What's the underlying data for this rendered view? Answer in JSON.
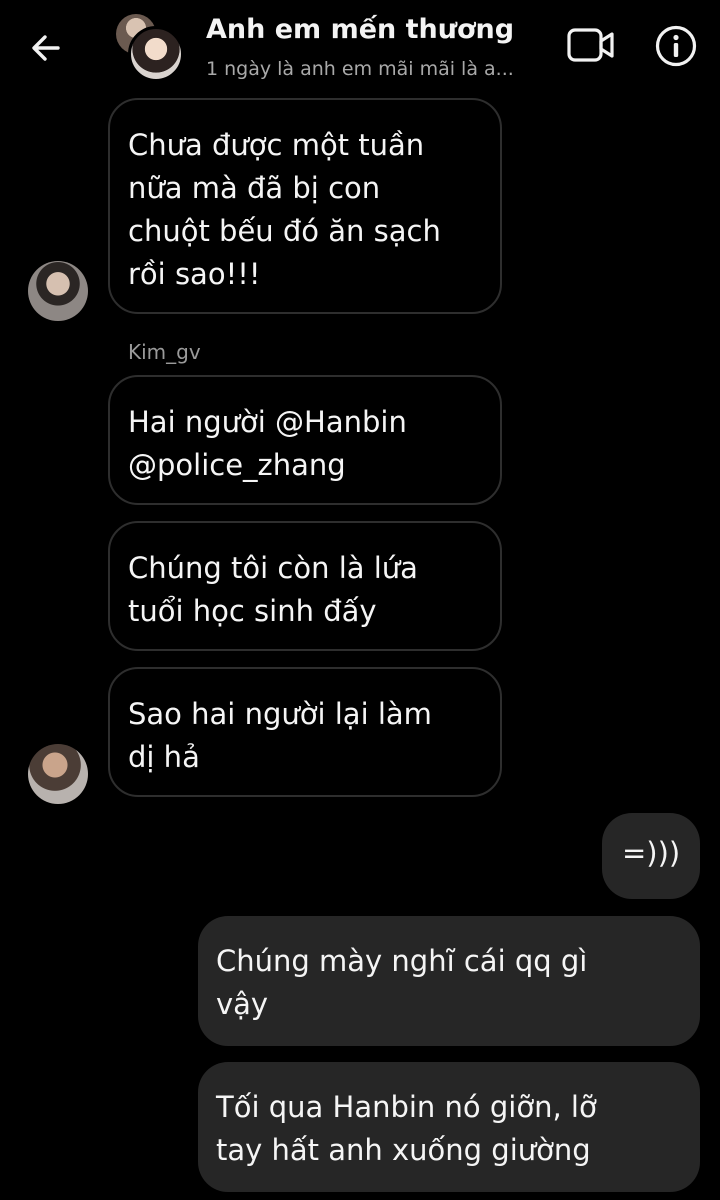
{
  "header": {
    "title": "Anh em mến thương",
    "subtitle": "1 ngày là anh em mãi mãi là a...",
    "back_icon": "arrow-left-icon",
    "video_icon": "video-call-icon",
    "info_icon": "info-icon"
  },
  "messages": [
    {
      "direction": "incoming",
      "text": "Chưa được một tuần\nnữa mà đã bị con\nchuột bếu đó ăn sạch\nrồi sao!!!"
    },
    {
      "direction": "incoming",
      "sender": "Kim_gv",
      "text": "Hai người @Hanbin\n@police_zhang"
    },
    {
      "direction": "incoming",
      "text": "Chúng tôi còn là lứa\ntuổi học sinh đấy"
    },
    {
      "direction": "incoming",
      "text": "Sao hai người lại làm\ndị hả"
    },
    {
      "direction": "outgoing",
      "text": "=)))"
    },
    {
      "direction": "outgoing",
      "text": "Chúng mày nghĩ cái qq gì\nvậy"
    },
    {
      "direction": "outgoing",
      "text": "Tối qua Hanbin nó giỡn, lỡ\ntay hất anh xuống giường"
    }
  ],
  "colors": {
    "background": "#000000",
    "incoming_border": "#2e2e2e",
    "outgoing_bubble": "#262626",
    "text": "#f5f5f5",
    "muted_text": "#a9a9a9"
  }
}
